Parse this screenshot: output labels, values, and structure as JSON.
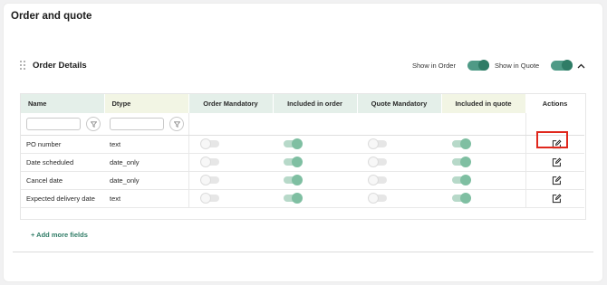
{
  "page": {
    "title": "Order and quote"
  },
  "section": {
    "title": "Order Details",
    "show_in_order_label": "Show in Order",
    "show_in_order_on": true,
    "show_in_quote_label": "Show in Quote",
    "show_in_quote_on": true,
    "collapse_icon": "chevron-up-icon"
  },
  "table": {
    "columns": [
      {
        "key": "name",
        "label": "Name"
      },
      {
        "key": "dtype",
        "label": "Dtype"
      },
      {
        "key": "order_mandatory",
        "label": "Order Mandatory"
      },
      {
        "key": "included_in_order",
        "label": "Included in order"
      },
      {
        "key": "quote_mandatory",
        "label": "Quote Mandatory"
      },
      {
        "key": "included_in_quote",
        "label": "Included in quote"
      },
      {
        "key": "actions",
        "label": "Actions"
      }
    ],
    "filters": {
      "name_placeholder": "",
      "dtype_placeholder": "",
      "filter_icon": "filter-icon"
    },
    "rows": [
      {
        "name": "PO number",
        "dtype": "text",
        "order_mandatory": false,
        "included_in_order": true,
        "quote_mandatory": false,
        "included_in_quote": true,
        "action_icon": "edit-icon"
      },
      {
        "name": "Date scheduled",
        "dtype": "date_only",
        "order_mandatory": false,
        "included_in_order": true,
        "quote_mandatory": false,
        "included_in_quote": true,
        "action_icon": "edit-icon"
      },
      {
        "name": "Cancel date",
        "dtype": "date_only",
        "order_mandatory": false,
        "included_in_order": true,
        "quote_mandatory": false,
        "included_in_quote": true,
        "action_icon": "edit-icon"
      },
      {
        "name": "Expected delivery date",
        "dtype": "text",
        "order_mandatory": false,
        "included_in_order": true,
        "quote_mandatory": false,
        "included_in_quote": true,
        "action_icon": "edit-icon"
      }
    ]
  },
  "add_more": {
    "label": "+ Add more fields"
  },
  "colors": {
    "accent": "#2f7c66",
    "toggle_on_light": "#7fbfa2",
    "highlight": "#e0281d",
    "header_green": "#e4efe9",
    "header_yellow": "#f2f5e4"
  }
}
